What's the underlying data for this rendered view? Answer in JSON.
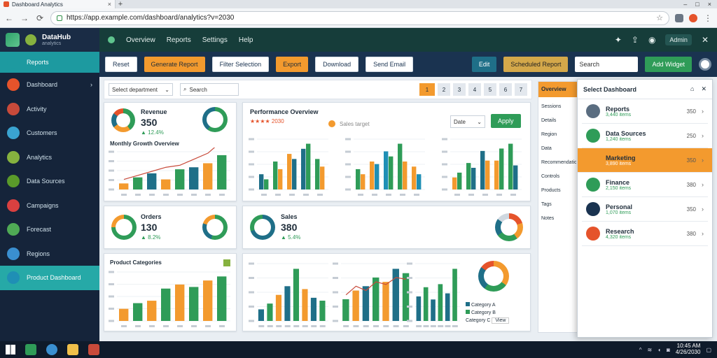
{
  "browser": {
    "tab_title": "Dashboard Analytics",
    "url": "https://app.example.com/dashboard/analytics?v=2030",
    "new_tab": "+",
    "close": "×",
    "back": "←",
    "forward": "→",
    "reload": "⟳",
    "minimize": "–",
    "maximize": "□",
    "winclose": "×"
  },
  "header": {
    "menus": [
      "Overview",
      "Reports",
      "Settings",
      "Help"
    ],
    "user": "Admin"
  },
  "sidebar": {
    "brand": "DataHub",
    "brand_sub": "analytics",
    "items": [
      {
        "label": "Reports",
        "color": "#1d9aa0"
      },
      {
        "label": "Dashboard",
        "color": "#e5532b"
      },
      {
        "label": "Activity",
        "color": "#c84a3a"
      },
      {
        "label": "Customers",
        "color": "#3aa3d0"
      },
      {
        "label": "Analytics",
        "color": "#86b23f"
      },
      {
        "label": "Data Sources",
        "color": "#5a9a2a"
      },
      {
        "label": "Campaigns",
        "color": "#d94040"
      },
      {
        "label": "Forecast",
        "color": "#4faa55"
      },
      {
        "label": "Regions",
        "color": "#3a8fd0"
      },
      {
        "label": "Product Dashboard",
        "color": "#1f8fb5"
      }
    ]
  },
  "toolbar": {
    "btn1": "Reset",
    "btn2": "Generate Report",
    "btn3": "Filter Selection",
    "btn4": "Export",
    "btn5": "Download",
    "btn6": "Send Email",
    "btn7": "Edit",
    "btn8": "Scheduled Report",
    "search_placeholder": "Search",
    "btn9": "Add Widget"
  },
  "filter": {
    "select": "Select department",
    "search": "Search",
    "icons": [
      "1",
      "2",
      "3",
      "4",
      "5",
      "6",
      "7"
    ]
  },
  "cards": {
    "kpi1": {
      "title": "Revenue",
      "value": "350",
      "sub": "▲ 12.4%"
    },
    "kpi1_chart": "Monthly Growth Overview",
    "kpi2": {
      "title": "Orders",
      "value": "130",
      "sub": "▲ 8.2%"
    },
    "kpi3": {
      "title": "Sales",
      "value": "380",
      "sub": "▲ 5.4%"
    },
    "main_chart": {
      "title": "Performance Overview",
      "sub": "★★★★ 2030",
      "legend": "Sales target",
      "filter": "Date",
      "button": "Apply"
    },
    "bottom_left": {
      "title": "Product Categories"
    },
    "bottom_legend": [
      "Category A",
      "Category B",
      "Category C"
    ],
    "bottom_button": "View"
  },
  "right_panel": {
    "title": "Overview",
    "labels": [
      "Sessions",
      "Details",
      "Region",
      "Data",
      "Recommendations",
      "Controls",
      "Products",
      "Tags",
      "Notes"
    ]
  },
  "popup": {
    "title": "Select Dashboard",
    "items": [
      {
        "name": "Reports",
        "meta": "3,440 items",
        "value": "350",
        "color": "#5a6d80"
      },
      {
        "name": "Data Sources",
        "meta": "1,240 items",
        "value": "250",
        "color": "#2f9c58"
      },
      {
        "name": "Marketing",
        "meta": "3,890 items",
        "value": "350",
        "color": "#f39a2e"
      },
      {
        "name": "Finance",
        "meta": "2,150 items",
        "value": "380",
        "color": "#2f9c58"
      },
      {
        "name": "Personal",
        "meta": "1,070 items",
        "value": "350",
        "color": "#1a3350"
      },
      {
        "name": "Research",
        "meta": "4,320 items",
        "value": "380",
        "color": "#e5532b"
      }
    ]
  },
  "taskbar": {
    "time": "10:45 AM",
    "date": "4/26/2030"
  },
  "chart_data": [
    {
      "type": "line",
      "name": "growth",
      "categories": [
        "1",
        "2",
        "3",
        "4",
        "5",
        "6",
        "7",
        "8"
      ],
      "series": [
        {
          "values": [
            10,
            14,
            18,
            22,
            24,
            30,
            36,
            48
          ]
        }
      ],
      "bars": [
        6,
        12,
        16,
        10,
        20,
        22,
        26,
        34
      ]
    },
    {
      "type": "bar",
      "name": "perf1",
      "categories": [
        "1",
        "2",
        "3",
        "4",
        "5"
      ],
      "series": [
        {
          "values": [
            30,
            55,
            70,
            80,
            60
          ]
        },
        {
          "values": [
            20,
            40,
            60,
            90,
            45
          ]
        }
      ]
    },
    {
      "type": "bar",
      "name": "perf2",
      "categories": [
        "1",
        "2",
        "3",
        "4",
        "5"
      ],
      "series": [
        {
          "values": [
            40,
            55,
            75,
            90,
            45
          ]
        },
        {
          "values": [
            30,
            50,
            65,
            55,
            30
          ]
        }
      ]
    },
    {
      "type": "bar",
      "name": "perf3",
      "categories": [
        "1",
        "2",
        "3",
        "4",
        "5"
      ],
      "series": [
        {
          "values": [
            25,
            55,
            80,
            60,
            95
          ]
        },
        {
          "values": [
            35,
            45,
            60,
            85,
            50
          ]
        }
      ]
    },
    {
      "type": "bar",
      "name": "bottom1",
      "categories": [
        "1",
        "2",
        "3",
        "4",
        "5",
        "6",
        "7",
        "8"
      ],
      "series": [
        {
          "values": [
            15,
            22,
            25,
            40,
            45,
            42,
            50,
            55
          ]
        }
      ]
    },
    {
      "type": "bar",
      "name": "bottom2",
      "categories": [
        "1",
        "2",
        "3",
        "4",
        "5",
        "6",
        "7",
        "8"
      ],
      "series": [
        {
          "values": [
            20,
            30,
            45,
            60,
            90,
            55,
            40,
            35
          ]
        }
      ]
    },
    {
      "type": "bar",
      "name": "bottom3",
      "categories": [
        "1",
        "2",
        "3",
        "4",
        "5",
        "6",
        "7"
      ],
      "series": [
        {
          "values": [
            25,
            35,
            40,
            50,
            45,
            60,
            55
          ]
        }
      ]
    },
    {
      "type": "bar",
      "name": "bottom4",
      "categories": [
        "1",
        "2",
        "3",
        "4",
        "5",
        "6"
      ],
      "series": [
        {
          "values": [
            40,
            55,
            35,
            60,
            45,
            85
          ]
        }
      ]
    }
  ]
}
